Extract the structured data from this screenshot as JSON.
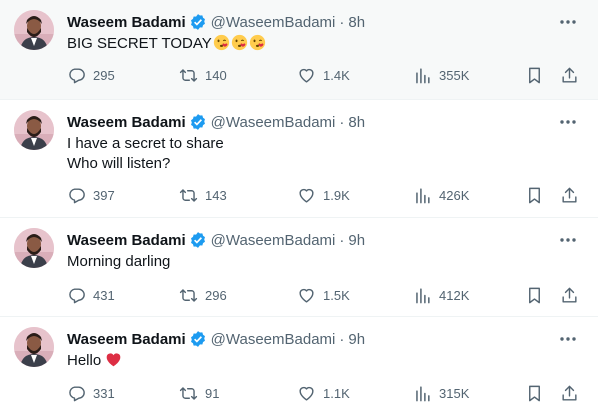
{
  "tweets": [
    {
      "author": "Waseem Badami",
      "handle": "@WaseemBadami",
      "sep": "·",
      "time": "8h",
      "lines": [
        "BIG SECRET TODAY"
      ],
      "emoji": "kissing-face-emoji x3",
      "replies": "295",
      "retweets": "140",
      "likes": "1.4K",
      "views": "355K"
    },
    {
      "author": "Waseem Badami",
      "handle": "@WaseemBadami",
      "sep": "·",
      "time": "8h",
      "lines": [
        "I have a secret to share",
        "Who will listen?"
      ],
      "replies": "397",
      "retweets": "143",
      "likes": "1.9K",
      "views": "426K"
    },
    {
      "author": "Waseem Badami",
      "handle": "@WaseemBadami",
      "sep": "·",
      "time": "9h",
      "lines": [
        "Morning darling"
      ],
      "replies": "431",
      "retweets": "296",
      "likes": "1.5K",
      "views": "412K"
    },
    {
      "author": "Waseem Badami",
      "handle": "@WaseemBadami",
      "sep": "·",
      "time": "9h",
      "lines": [
        "Hello"
      ],
      "emoji": "red-heart-emoji",
      "replies": "331",
      "retweets": "91",
      "likes": "1.1K",
      "views": "315K"
    }
  ],
  "colors": {
    "verified": "#1d9bf0",
    "text": "#0f1419",
    "muted": "#536471",
    "heart": "#dd2e44"
  }
}
